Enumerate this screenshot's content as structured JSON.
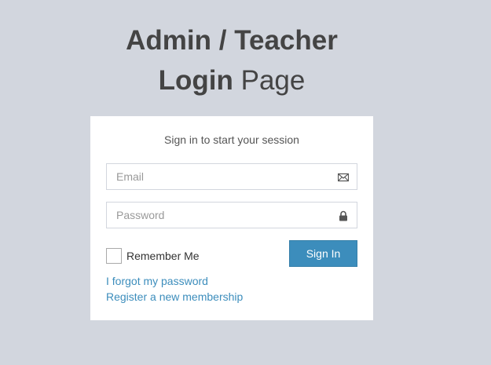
{
  "header": {
    "title_bold_1": "Admin / Teacher",
    "title_bold_2": "Login",
    "title_light": "Page"
  },
  "login": {
    "message": "Sign in to start your session",
    "email": {
      "placeholder": "Email",
      "value": "",
      "icon": "envelope-icon"
    },
    "password": {
      "placeholder": "Password",
      "value": "",
      "icon": "lock-icon"
    },
    "remember_label": "Remember Me",
    "remember_checked": false,
    "signin_label": "Sign In",
    "forgot_link": "I forgot my password",
    "register_link": "Register a new membership"
  },
  "colors": {
    "background": "#d2d6de",
    "primary": "#3c8dbc",
    "link": "#3c8dbc",
    "title": "#444444"
  }
}
